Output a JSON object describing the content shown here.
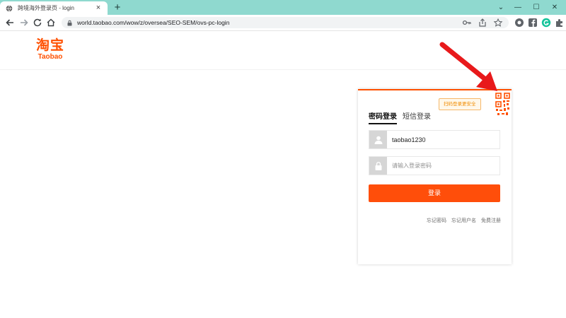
{
  "browser": {
    "tab_title": "跨境海外登录页 - login",
    "tab_close": "×",
    "new_tab": "+",
    "url": "world.taobao.com/wow/z/oversea/SEO-SEM/ovs-pc-login",
    "window_controls": [
      "⌄",
      "—",
      "☐",
      "✕"
    ]
  },
  "page": {
    "logo_cn": "淘宝",
    "logo_en": "Taobao"
  },
  "login": {
    "qr_tip": "扫码登录更安全",
    "tabs": [
      "密码登录",
      "短信登录"
    ],
    "username_value": "taobao1230",
    "password_placeholder": "请输入登录密码",
    "submit_label": "登录",
    "links": [
      "忘记密码",
      "忘记用户名",
      "免费注册"
    ]
  },
  "colors": {
    "brand": "#ff5000",
    "tabstrip": "#8fd9cf",
    "arrow": "#e8191b"
  },
  "icons": [
    "globe-icon",
    "back-icon",
    "forward-icon",
    "reload-icon",
    "home-icon",
    "lock-icon",
    "key-icon",
    "share-icon",
    "star-icon",
    "extension-icons",
    "qr-code-icon",
    "user-icon",
    "padlock-icon"
  ]
}
